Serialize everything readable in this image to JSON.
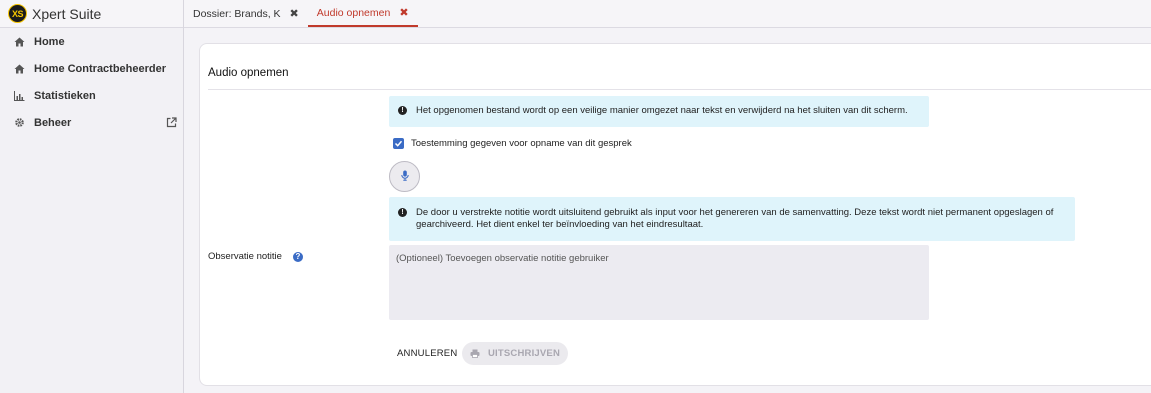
{
  "brand": {
    "logo_text": "XS",
    "name": "Xpert Suite"
  },
  "sidebar": {
    "items": [
      {
        "label": "Home",
        "icon": "home-icon"
      },
      {
        "label": "Home Contractbeheerder",
        "icon": "home-icon"
      },
      {
        "label": "Statistieken",
        "icon": "bar-chart-icon"
      },
      {
        "label": "Beheer",
        "icon": "gear-icon",
        "trailing_icon": "external-link-icon"
      }
    ]
  },
  "tabs": [
    {
      "label": "Dossier: Brands, K",
      "close": "✖",
      "active": false
    },
    {
      "label": "Audio opnemen",
      "close": "✖",
      "active": true
    }
  ],
  "form": {
    "title": "Audio opnemen",
    "info1": "Het opgenomen bestand wordt op een veilige manier omgezet naar tekst en verwijderd na het sluiten van dit scherm.",
    "consent_label": "Toestemming gegeven voor opname van dit gesprek",
    "consent_checked": true,
    "info2": "De door u verstrekte notitie wordt uitsluitend gebruikt als input voor het genereren van de samenvatting. Deze tekst wordt niet permanent opgeslagen of gearchiveerd. Het dient enkel ter beïnvloeding van het eindresultaat.",
    "observation_label": "Observatie notitie",
    "observation_placeholder": "(Optioneel) Toevoegen observatie notitie gebruiker",
    "observation_value": "",
    "cancel_label": "ANNULEREN",
    "submit_label": "UITSCHRIJVEN"
  },
  "colors": {
    "accent": "#c0392b",
    "primary": "#3a6bc5",
    "info_bg": "#dff4fb"
  }
}
